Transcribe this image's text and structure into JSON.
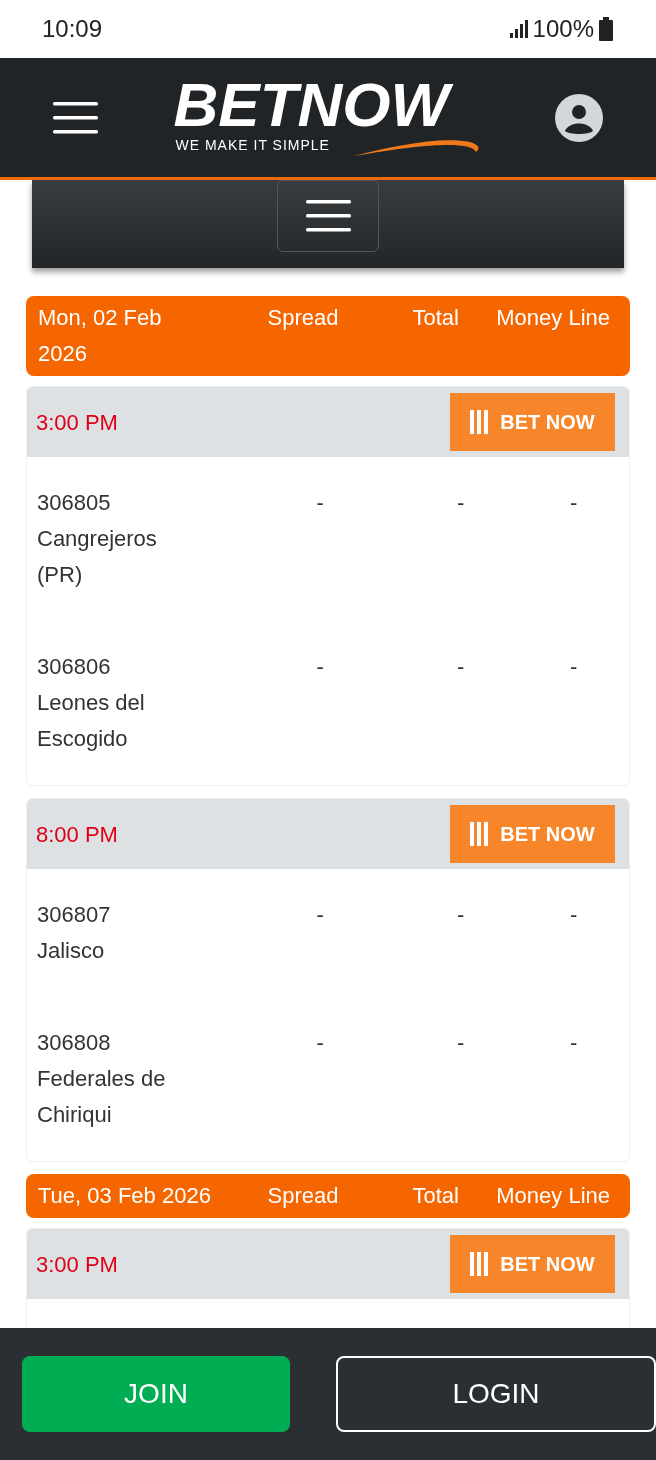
{
  "status_bar": {
    "time": "10:09",
    "battery": "100%"
  },
  "header": {
    "logo": "BETNOW",
    "tagline": "WE MAKE IT SIMPLE"
  },
  "days": [
    {
      "date": "Mon, 02 Feb 2026",
      "columns": [
        "Spread",
        "Total",
        "Money Line"
      ],
      "games": [
        {
          "time": "3:00 PM",
          "button": "BET NOW",
          "teams": [
            {
              "rot": "306805",
              "name": "Cangrejeros (PR)",
              "spread": "-",
              "total": "-",
              "money_line": "-"
            },
            {
              "rot": "306806",
              "name": "Leones del Escogido",
              "spread": "-",
              "total": "-",
              "money_line": "-"
            }
          ]
        },
        {
          "time": "8:00 PM",
          "button": "BET NOW",
          "teams": [
            {
              "rot": "306807",
              "name": "Jalisco",
              "spread": "-",
              "total": "-",
              "money_line": "-"
            },
            {
              "rot": "306808",
              "name": "Federales de Chiriqui",
              "spread": "-",
              "total": "-",
              "money_line": "-"
            }
          ]
        }
      ]
    },
    {
      "date": "Tue, 03 Feb 2026",
      "columns": [
        "Spread",
        "Total",
        "Money Line"
      ],
      "games": [
        {
          "time": "3:00 PM",
          "button": "BET NOW"
        }
      ]
    }
  ],
  "footer": {
    "buttons": [
      "JOIN",
      "LOGIN"
    ]
  }
}
